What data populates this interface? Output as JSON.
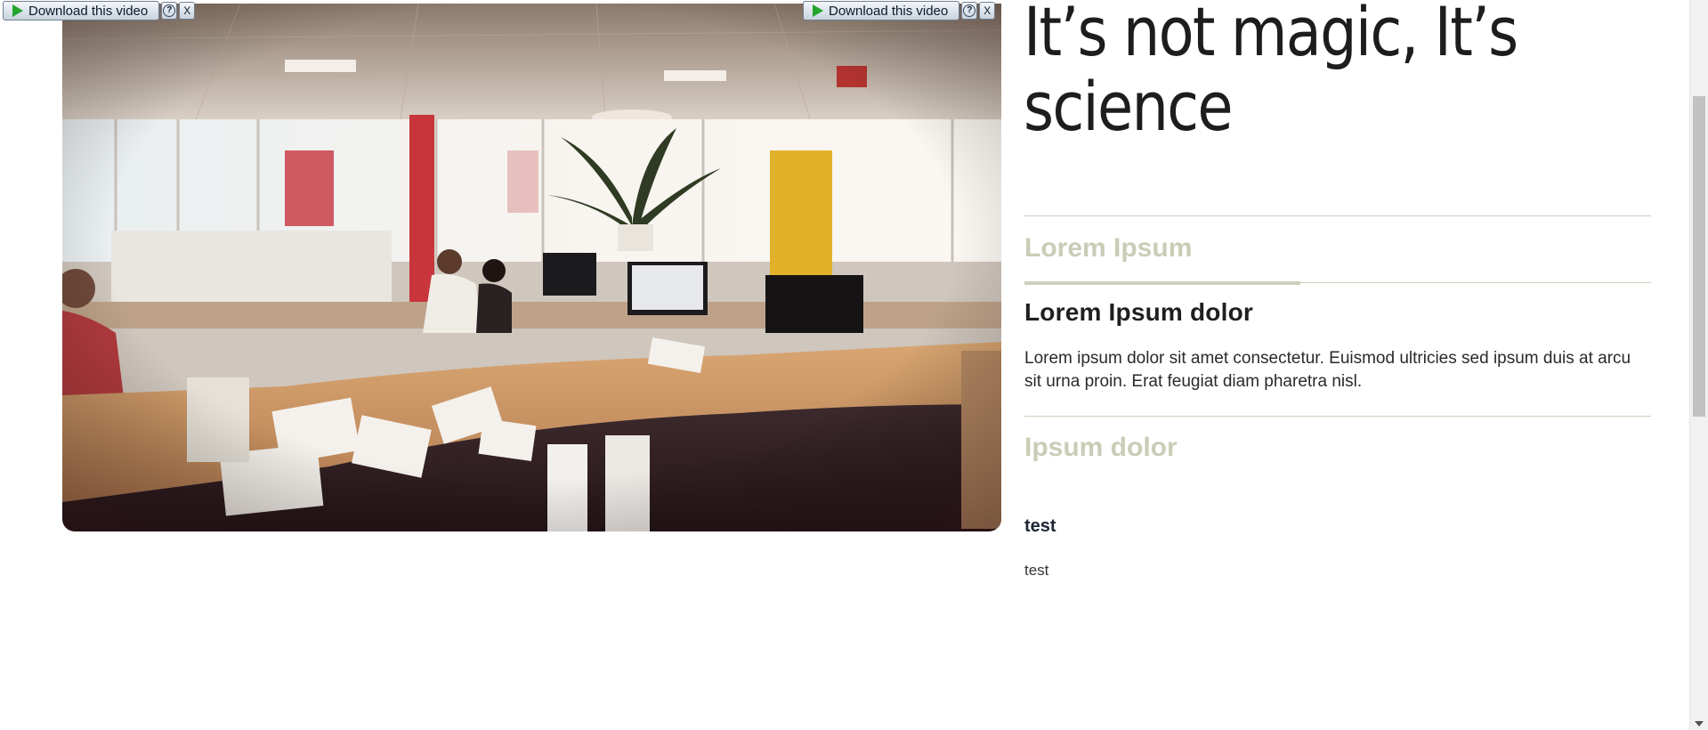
{
  "download_bars": [
    {
      "label": "Download this video",
      "help": "?",
      "close": "X"
    },
    {
      "label": "Download this video",
      "help": "?",
      "close": "X"
    }
  ],
  "headline": "It’s not magic, It’s science",
  "accordion": {
    "items": [
      {
        "title": "Lorem Ipsum",
        "state": "collapsed"
      },
      {
        "title": "Lorem Ipsum dolor",
        "state": "expanded",
        "body": "Lorem ipsum dolor sit amet consectetur. Euismod ultricies sed ipsum duis at arcu sit urna proin. Erat feugiat diam pharetra nisl."
      },
      {
        "title": "Ipsum dolor",
        "state": "collapsed"
      }
    ],
    "progress_fraction": 0.44
  },
  "test_block": {
    "heading": "test",
    "text": "test"
  },
  "colors": {
    "muted_title": "#c9cdb7",
    "divider": "#cfcdbd",
    "play_green": "#23a52e"
  },
  "icons": [
    "play-icon",
    "help-icon",
    "close-icon",
    "scroll-down-arrow-icon"
  ]
}
